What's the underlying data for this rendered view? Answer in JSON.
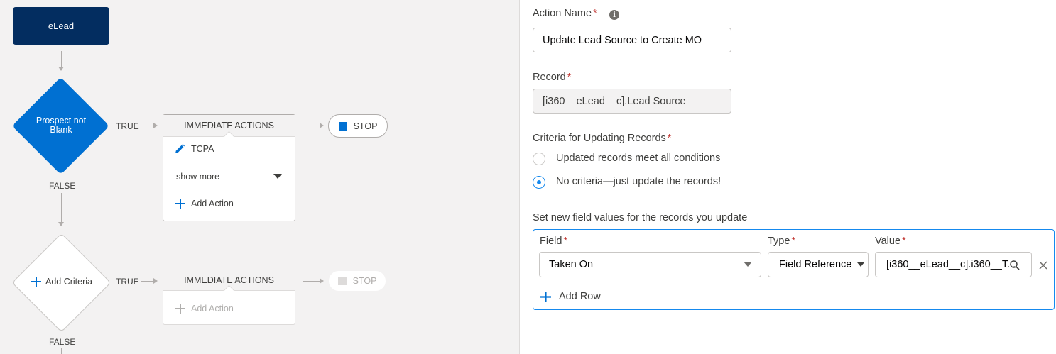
{
  "canvas": {
    "start_node": "eLead",
    "criteria1": {
      "label": "Prospect not Blank",
      "true_label": "TRUE",
      "false_label": "FALSE"
    },
    "actions1": {
      "header": "IMMEDIATE ACTIONS",
      "item": "TCPA",
      "show_more": "show more",
      "add_action": "Add Action"
    },
    "stop1": "STOP",
    "criteria2": {
      "label": "Add Criteria",
      "true_label": "TRUE",
      "false_label": "FALSE"
    },
    "actions2": {
      "header": "IMMEDIATE ACTIONS",
      "add_action": "Add Action"
    },
    "stop2": "STOP"
  },
  "panel": {
    "action_name": {
      "label": "Action Name",
      "value": "Update Lead Source to Create MO"
    },
    "record": {
      "label": "Record",
      "value": "[i360__eLead__c].Lead Source"
    },
    "criteria": {
      "label": "Criteria for Updating Records",
      "options": [
        {
          "label": "Updated records meet all conditions",
          "selected": false
        },
        {
          "label": "No criteria—just update the records!",
          "selected": true
        }
      ]
    },
    "set_values": {
      "label": "Set new field values for the records you update",
      "field_header": "Field",
      "type_header": "Type",
      "value_header": "Value",
      "row": {
        "field": "Taken On",
        "type": "Field Reference",
        "value": "[i360__eLead__c].i360__T..."
      },
      "add_row": "Add Row"
    }
  },
  "colors": {
    "accent": "#0070d2",
    "navy": "#032d60",
    "required": "#c23934"
  }
}
